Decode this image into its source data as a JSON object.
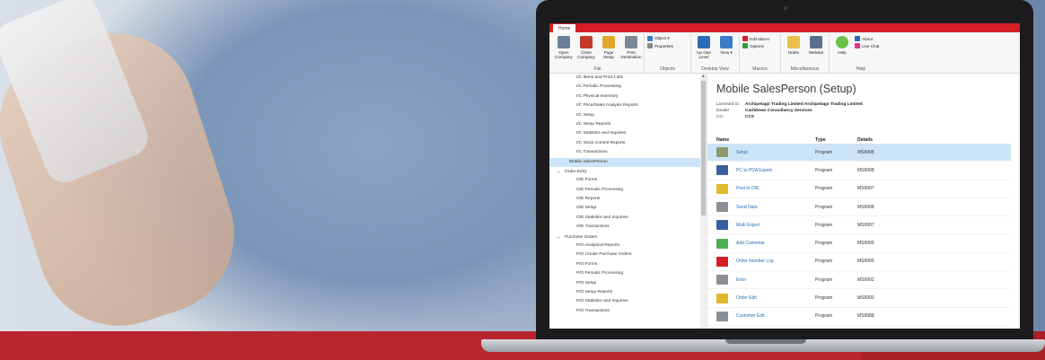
{
  "ribbon": {
    "tab": "Home",
    "groups": {
      "file": {
        "label": "File",
        "buttons": [
          {
            "label": "Open Company",
            "icon": "factory-icon",
            "color": "#6a7f99"
          },
          {
            "label": "Close Company",
            "icon": "close-factory-icon",
            "color": "#c0392b"
          },
          {
            "label": "Page Setup",
            "icon": "page-setup-icon",
            "color": "#e1a82c"
          },
          {
            "label": "Print Destination",
            "icon": "printer-icon",
            "color": "#7b8796"
          }
        ]
      },
      "objects": {
        "label": "Objects",
        "items": [
          "Object ▾",
          "Properties"
        ],
        "icon_colors": [
          "#3a7bc8",
          "#888888"
        ]
      },
      "desktop_view": {
        "label": "Desktop View",
        "buttons": [
          {
            "label": "Up One Level",
            "icon": "up-arrow-icon",
            "color": "#2a6db5"
          },
          {
            "label": "View ▾",
            "icon": "view-grid-icon",
            "color": "#3a7bc8"
          }
        ]
      },
      "macros": {
        "label": "Macros",
        "items": [
          "Edit Macro",
          "Options"
        ],
        "icon_colors": [
          "#d41f26",
          "#2e9e3e"
        ]
      },
      "misc": {
        "label": "Miscellaneous",
        "buttons": [
          {
            "label": "Notes",
            "icon": "notes-icon",
            "color": "#e8c14a"
          },
          {
            "label": "Website",
            "icon": "globe-icon",
            "color": "#5a6f8a"
          }
        ]
      },
      "help": {
        "label": "Help",
        "button": {
          "label": "Help",
          "icon": "help-icon",
          "color": "#6cc04a"
        },
        "items": [
          "About",
          "Live Chat"
        ],
        "icon_colors": [
          "#2a6db5",
          "#e0338d"
        ]
      }
    }
  },
  "tree": {
    "rows": [
      {
        "label": "I/C Items and Price Lists",
        "level": "l2"
      },
      {
        "label": "I/C Periodic Processing",
        "level": "l2"
      },
      {
        "label": "I/C Physical Inventory",
        "level": "l2"
      },
      {
        "label": "I/C Price/Sales Analysis Reports",
        "level": "l2"
      },
      {
        "label": "I/C Setup",
        "level": "l2"
      },
      {
        "label": "I/C Setup Reports",
        "level": "l2"
      },
      {
        "label": "I/C Statistics and Inquiries",
        "level": "l2"
      },
      {
        "label": "I/C Stock Control Reports",
        "level": "l2"
      },
      {
        "label": "I/C Transactions",
        "level": "l2"
      },
      {
        "label": "Mobile SalesPerson",
        "level": "l1p",
        "selected": true
      },
      {
        "label": "Order Entry",
        "level": "l1",
        "chevron": "⌄"
      },
      {
        "label": "O/E Forms",
        "level": "l2"
      },
      {
        "label": "O/E Periodic Processing",
        "level": "l2"
      },
      {
        "label": "O/E Reports",
        "level": "l2"
      },
      {
        "label": "O/E Setup",
        "level": "l2"
      },
      {
        "label": "O/E Statistics and Inquiries",
        "level": "l2"
      },
      {
        "label": "O/E Transactions",
        "level": "l2"
      },
      {
        "label": "Purchase Orders",
        "level": "l1",
        "chevron": "⌄"
      },
      {
        "label": "P/O Analytical Reports",
        "level": "l2"
      },
      {
        "label": "P/O Create Purchase Orders",
        "level": "l2"
      },
      {
        "label": "P/O Forms",
        "level": "l2"
      },
      {
        "label": "P/O Periodic Processing",
        "level": "l2"
      },
      {
        "label": "P/O Setup",
        "level": "l2"
      },
      {
        "label": "P/O Setup Reports",
        "level": "l2"
      },
      {
        "label": "P/O Statistics and Inquiries",
        "level": "l2"
      },
      {
        "label": "P/O Transactions",
        "level": "l2"
      }
    ]
  },
  "main": {
    "title": "Mobile SalesPerson (Setup)",
    "meta": [
      {
        "key": "Licensed to:",
        "value": "Archipelago Trading Limited   Archipelago Trading Limited"
      },
      {
        "key": "Dealer:",
        "value": "Caribbean Consultancy Services"
      },
      {
        "key": "CC:",
        "value": "CCS"
      }
    ],
    "columns": {
      "name": "Name",
      "type": "Type",
      "details": "Details"
    },
    "rows": [
      {
        "name": "Setup",
        "type": "Program",
        "details": "MS9998",
        "icon": "folder-icon",
        "color": "#8a9a6b",
        "selected": true
      },
      {
        "name": "PC to PDA Export",
        "type": "Program",
        "details": "MS9998",
        "icon": "export-icon",
        "color": "#3a5fa0"
      },
      {
        "name": "Post to O/E",
        "type": "Program",
        "details": "MS9997",
        "icon": "post-icon",
        "color": "#e1b92c"
      },
      {
        "name": "Send Data",
        "type": "Program",
        "details": "MS9998",
        "icon": "send-data-icon",
        "color": "#8a8f96"
      },
      {
        "name": "Multi Export",
        "type": "Program",
        "details": "MS9997",
        "icon": "multi-export-icon",
        "color": "#3a5fa0"
      },
      {
        "name": "Add Customer",
        "type": "Program",
        "details": "MS9995",
        "icon": "add-customer-icon",
        "color": "#4caf50"
      },
      {
        "name": "Order Number Log",
        "type": "Program",
        "details": "MS9995",
        "icon": "checklist-icon",
        "color": "#d41f26"
      },
      {
        "name": "Error",
        "type": "Program",
        "details": "MS9992",
        "icon": "error-icon",
        "color": "#8a8f96"
      },
      {
        "name": "Order Edit",
        "type": "Program",
        "details": "MS9990",
        "icon": "order-edit-icon",
        "color": "#e1b92c"
      },
      {
        "name": "Customer Edit",
        "type": "Program",
        "details": "MS9988",
        "icon": "customer-edit-icon",
        "color": "#8a8f96"
      }
    ]
  }
}
